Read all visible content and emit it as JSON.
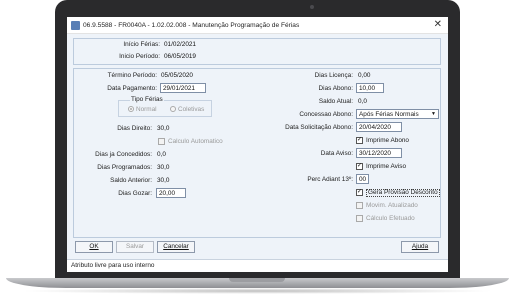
{
  "window": {
    "title": "06.9.5588 - FR0040A - 1.02.02.008 - Manutenção Programação de Férias",
    "close_glyph": "✕"
  },
  "top": {
    "inicio_ferias_label": "Início Férias:",
    "inicio_ferias_value": "01/02/2021",
    "inicio_periodo_label": "Inicio Período:",
    "inicio_periodo_value": "06/05/2019"
  },
  "left": {
    "termino_periodo_label": "Término Período:",
    "termino_periodo_value": "05/05/2020",
    "data_pagamento_label": "Data Pagamento:",
    "data_pagamento_value": "29/01/2021",
    "tipo_ferias_title": "Tipo Férias",
    "tipo_ferias_options": [
      "Normal",
      "Coletivas"
    ],
    "tipo_ferias_selected": "Normal",
    "dias_direito_label": "Dias Direito:",
    "dias_direito_value": "30,0",
    "calculo_automatico_label": "Calculo Automatico",
    "dias_ja_concedidos_label": "Dias ja Concedidos:",
    "dias_ja_concedidos_value": "0,0",
    "dias_programados_label": "Dias Programados:",
    "dias_programados_value": "30,0",
    "saldo_anterior_label": "Saldo Anterior:",
    "saldo_anterior_value": "30,0",
    "dias_gozar_label": "Dias Gozar:",
    "dias_gozar_value": "20,00"
  },
  "right": {
    "dias_licenca_label": "Dias Licença:",
    "dias_licenca_value": "0,00",
    "dias_abono_label": "Dias Abono:",
    "dias_abono_value": "10,00",
    "saldo_atual_label": "Saldo Atual:",
    "saldo_atual_value": "0,0",
    "concessao_abono_label": "Concessao Abono:",
    "concessao_abono_value": "Após Férias Normais",
    "data_solicitacao_abono_label": "Data Solicitação Abono:",
    "data_solicitacao_abono_value": "20/04/2020",
    "imprime_abono_label": "Imprime Abono",
    "data_aviso_label": "Data Aviso:",
    "data_aviso_value": "30/12/2020",
    "imprime_aviso_label": "Imprime Aviso",
    "perc_adiant_label": "Perc Adiant 13º:",
    "perc_adiant_value": "00",
    "gera_provisao_label": "Gera Provisão Desconto",
    "movim_atualizado_label": "Movim. Atualizado",
    "calculo_efetuado_label": "Cálculo Efetuado",
    "check_glyph": "✓"
  },
  "buttons": {
    "ok": "OK",
    "salvar": "Salvar",
    "cancelar": "Cancelar",
    "ajuda": "Ajuda"
  },
  "statusbar": {
    "text": "Atributo livre para uso interno"
  }
}
